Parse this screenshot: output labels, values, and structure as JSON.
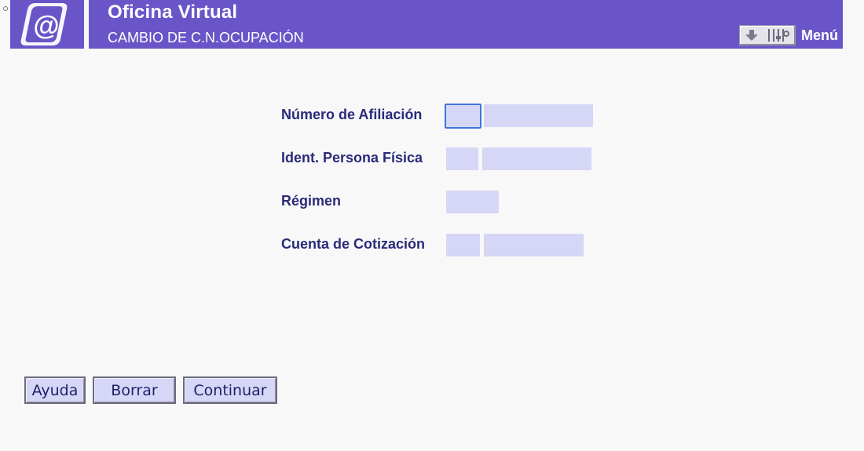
{
  "header": {
    "title": "Oficina Virtual",
    "subtitle": "CAMBIO DE C.N.OCUPACIÓN",
    "menu_label": "Menú",
    "logo_icon": "at-sign-logo-icon",
    "menu_icons": [
      "download-arrow-icon",
      "settings-sliders-icon"
    ],
    "background_color": "#6a55c8"
  },
  "form": {
    "fields": [
      {
        "label": "Número de Afiliación",
        "inputs": [
          "",
          ""
        ]
      },
      {
        "label": "Ident. Persona Física",
        "inputs": [
          "",
          ""
        ]
      },
      {
        "label": "Régimen",
        "inputs": [
          ""
        ]
      },
      {
        "label": "Cuenta de Cotización",
        "inputs": [
          "",
          ""
        ]
      }
    ],
    "input_color": "#d6d6f6",
    "label_color": "#2a2a7a"
  },
  "buttons": {
    "help": "Ayuda",
    "clear": "Borrar",
    "continue": "Continuar"
  }
}
